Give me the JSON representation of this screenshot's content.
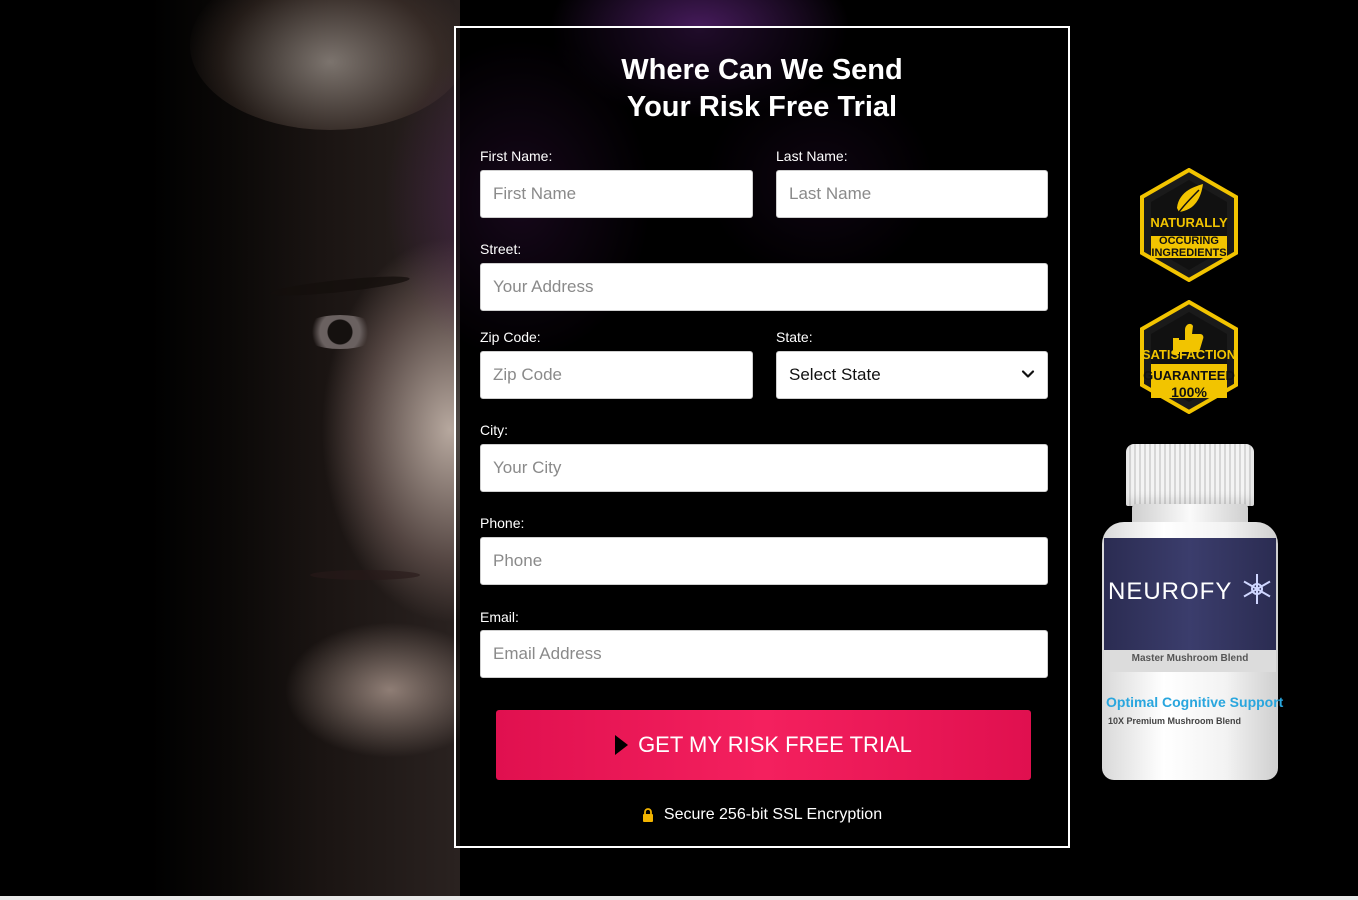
{
  "form": {
    "title_line1": "Where Can We Send",
    "title_line2": "Your Risk Free Trial",
    "fields": {
      "first_name": {
        "label": "First Name:",
        "placeholder": "First Name"
      },
      "last_name": {
        "label": "Last Name:",
        "placeholder": "Last Name"
      },
      "street": {
        "label": "Street:",
        "placeholder": "Your Address"
      },
      "zip": {
        "label": "Zip Code:",
        "placeholder": "Zip Code"
      },
      "state": {
        "label": "State:",
        "selected": "Select State"
      },
      "city": {
        "label": "City:",
        "placeholder": "Your City"
      },
      "phone": {
        "label": "Phone:",
        "placeholder": "Phone"
      },
      "email": {
        "label": "Email:",
        "placeholder": "Email Address"
      }
    },
    "submit_label": "GET MY RISK FREE TRIAL",
    "secure_text": "Secure 256-bit SSL Encryption"
  },
  "badges": {
    "natural": {
      "line1": "NATURALLY",
      "line2": "OCCURING",
      "line3": "INGREDIENTS"
    },
    "guarantee": {
      "line1": "SATISFACTION",
      "line2": "GUARANTEED",
      "line3": "100%"
    }
  },
  "product": {
    "brand": "NEUROFY",
    "subtitle": "Master Mushroom Blend",
    "tagline": "Optimal Cognitive Support",
    "detail": "10X Premium Mushroom Blend"
  },
  "colors": {
    "accent": "#ec1a56",
    "badge_gold": "#f2c400",
    "panel_border": "#ffffff"
  },
  "icons": [
    "play-icon",
    "lock-icon",
    "chevron-down-icon",
    "leaf-icon",
    "thumbs-up-icon",
    "snowflake-icon"
  ]
}
